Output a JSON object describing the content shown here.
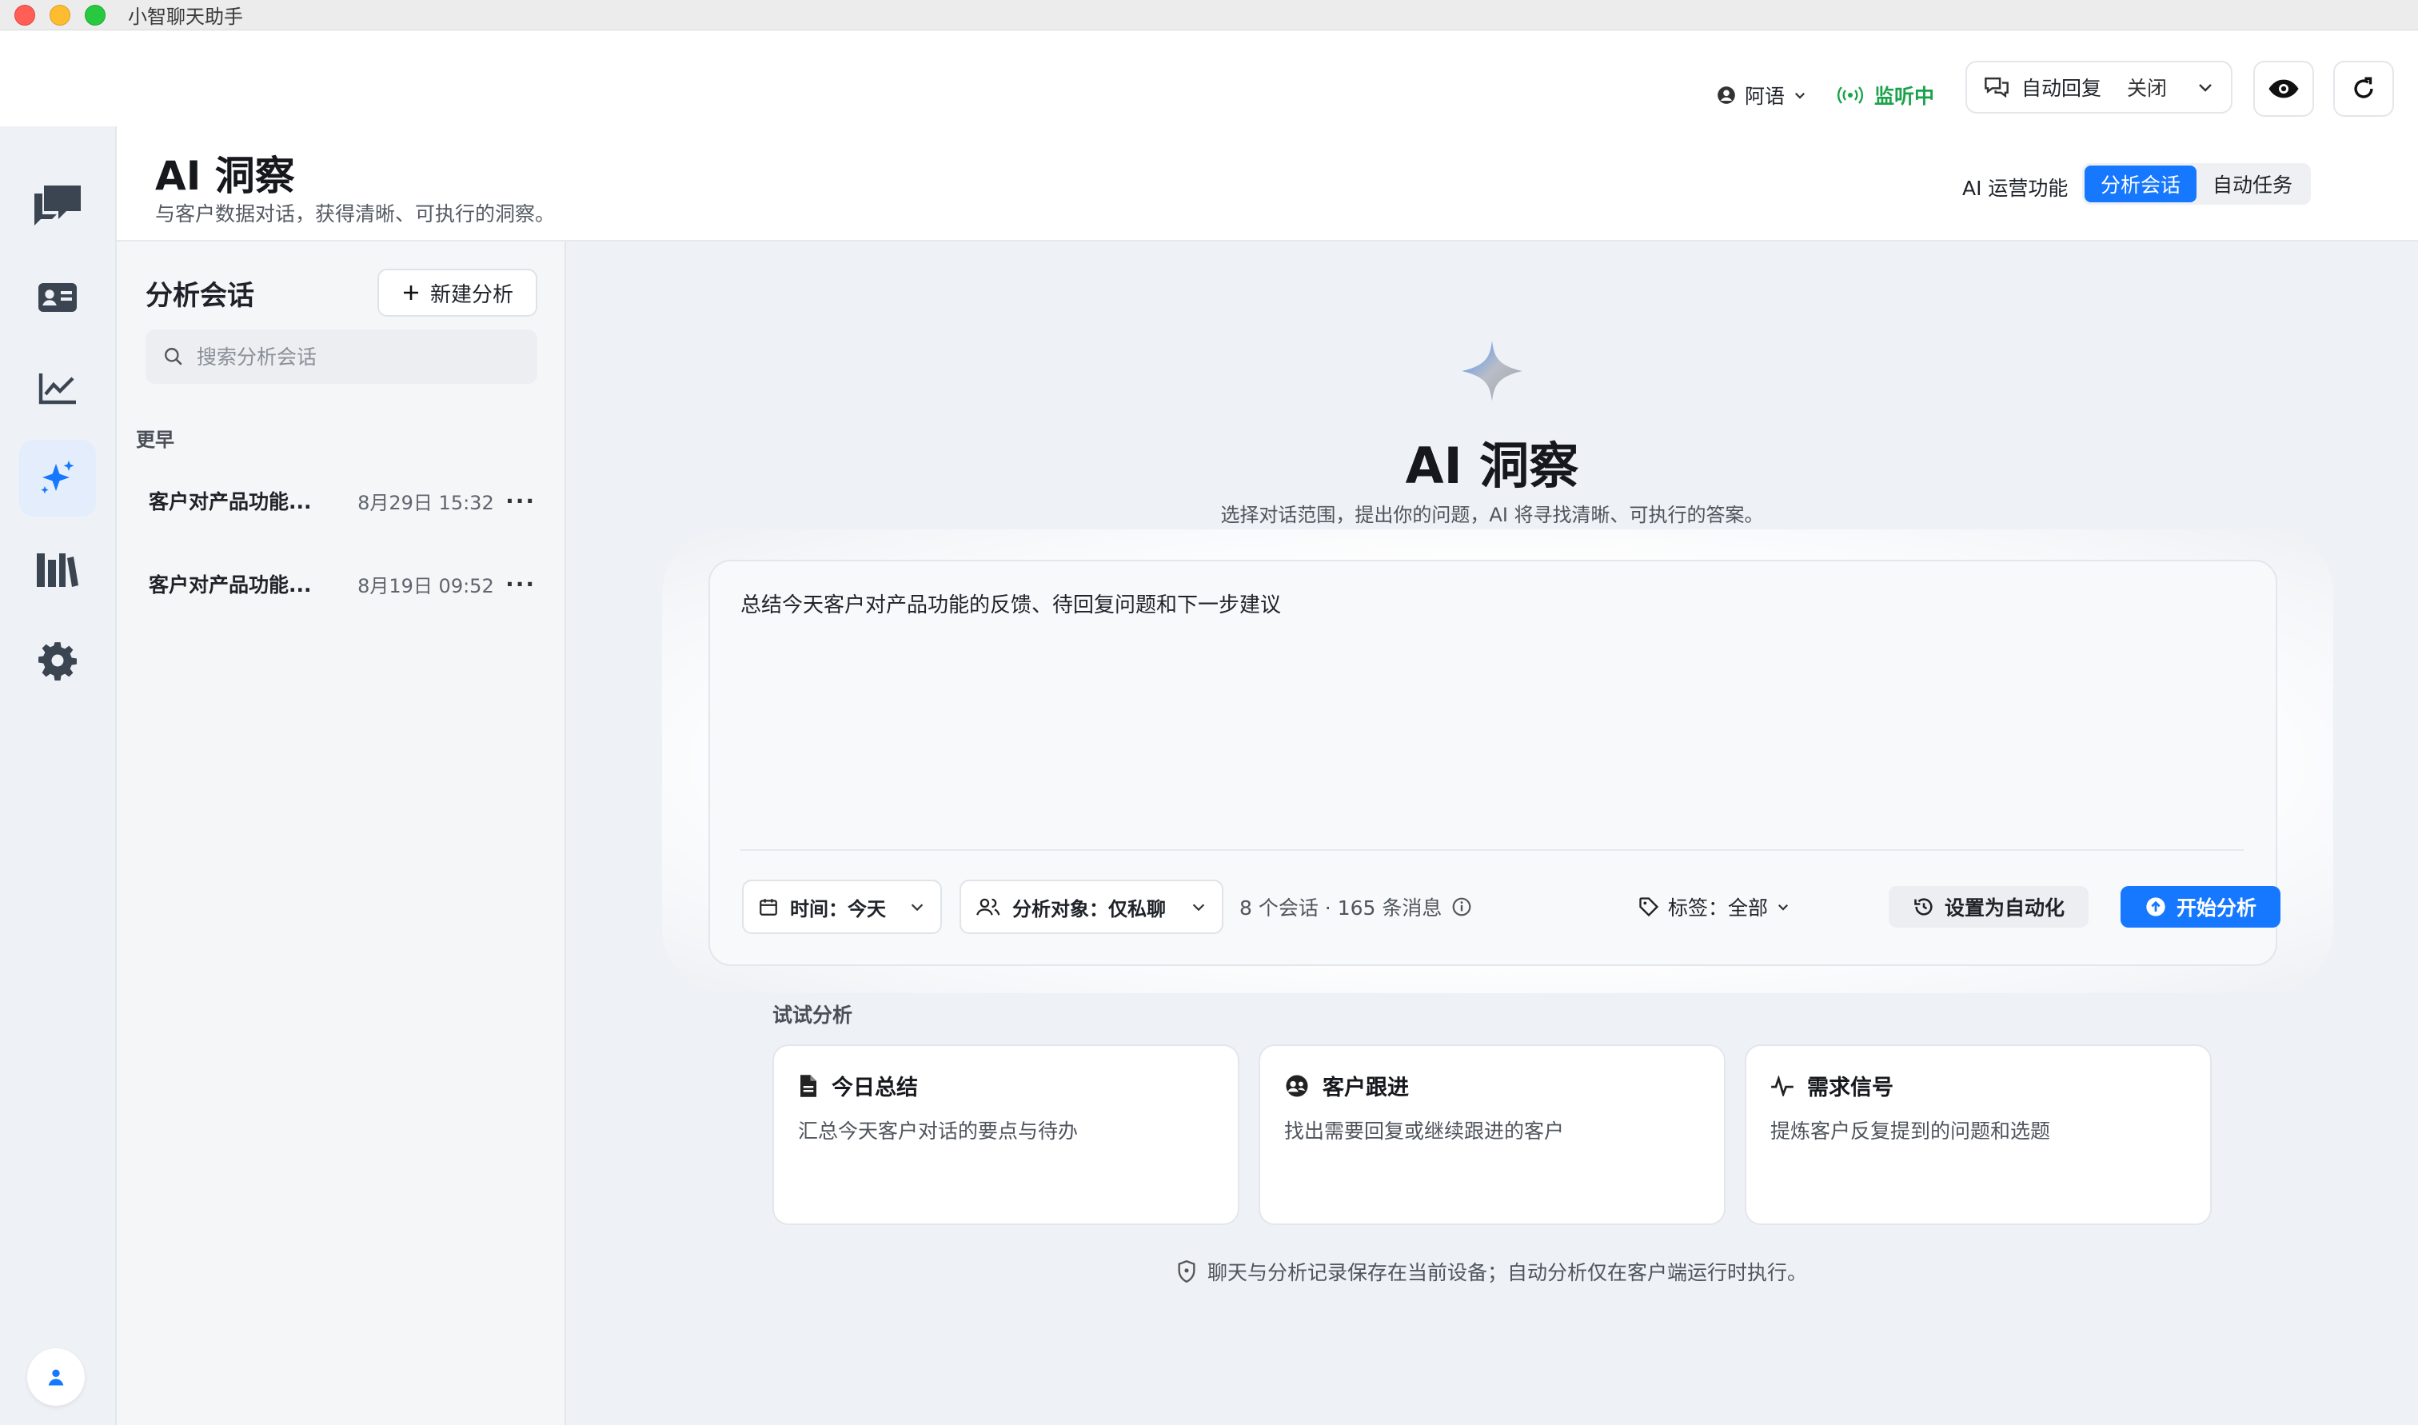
{
  "window": {
    "title": "小智聊天助手"
  },
  "topbar": {
    "user": "阿语",
    "listening": "监听中",
    "auto_reply_label": "自动回复",
    "auto_reply_state": "关闭"
  },
  "rail": {
    "items": [
      "chat-icon",
      "contacts-icon",
      "stats-icon",
      "ai-insight-icon",
      "library-icon",
      "settings-icon"
    ],
    "active": "ai-insight-icon"
  },
  "header": {
    "title": "AI 洞察",
    "subtitle": "与客户数据对话，获得清晰、可执行的洞察。",
    "ops_label": "AI 运营功能",
    "tabs": [
      {
        "label": "分析会话",
        "active": true
      },
      {
        "label": "自动任务",
        "active": false
      }
    ]
  },
  "sessions": {
    "title": "分析会话",
    "new_label": "新建分析",
    "search_placeholder": "搜索分析会话",
    "group": "更早",
    "items": [
      {
        "title": "客户对产品功能...",
        "time": "8月29日 15:32"
      },
      {
        "title": "客户对产品功能...",
        "time": "8月19日 09:52"
      }
    ]
  },
  "main": {
    "title": "AI 洞察",
    "subtitle": "选择对话范围，提出你的问题，AI 将寻找清晰、可执行的答案。",
    "prompt": "总结今天客户对产品功能的反馈、待回复问题和下一步建议",
    "time_filter": "时间：今天",
    "target_filter": "分析对象：仅私聊",
    "stats": "8 个会话 · 165 条消息",
    "tags_filter": "标签：全部",
    "automate_label": "设置为自动化",
    "start_label": "开始分析",
    "try_label": "试试分析",
    "cards": [
      {
        "title": "今日总结",
        "desc": "汇总今天客户对话的要点与待办"
      },
      {
        "title": "客户跟进",
        "desc": "找出需要回复或继续跟进的客户"
      },
      {
        "title": "需求信号",
        "desc": "提炼客户反复提到的问题和选题"
      }
    ],
    "footnote": "聊天与分析记录保存在当前设备；自动分析仅在客户端运行时执行。"
  },
  "colors": {
    "accent": "#1677ff",
    "listening": "#1aa34a"
  }
}
